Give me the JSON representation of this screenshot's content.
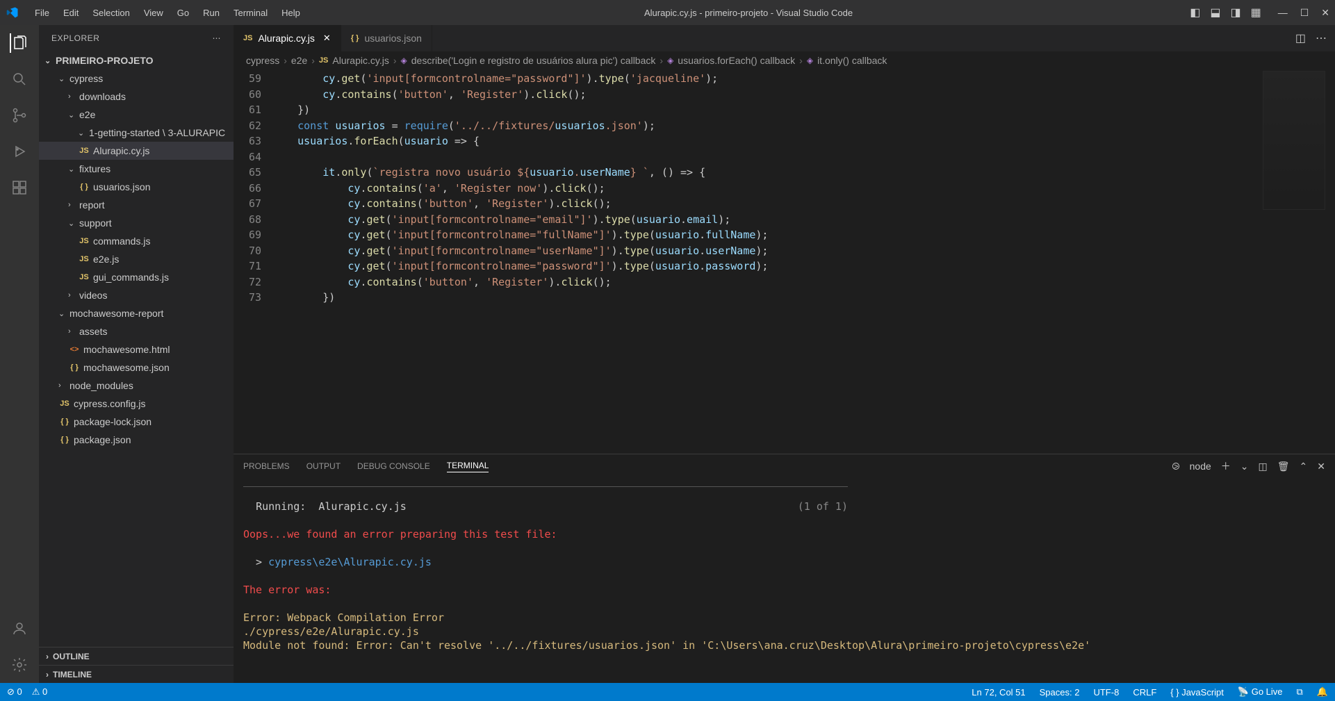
{
  "title": "Alurapic.cy.js - primeiro-projeto - Visual Studio Code",
  "menu": [
    "File",
    "Edit",
    "Selection",
    "View",
    "Go",
    "Run",
    "Terminal",
    "Help"
  ],
  "explorer": {
    "title": "EXPLORER",
    "root": "PRIMEIRO-PROJETO"
  },
  "tree": [
    {
      "label": "cypress",
      "type": "folder",
      "open": true,
      "indent": 1
    },
    {
      "label": "downloads",
      "type": "folder",
      "open": false,
      "indent": 2
    },
    {
      "label": "e2e",
      "type": "folder",
      "open": true,
      "indent": 2
    },
    {
      "label": "1-getting-started \\ 3-ALURAPIC",
      "type": "folder",
      "open": true,
      "indent": 3
    },
    {
      "label": "Alurapic.cy.js",
      "type": "js",
      "indent": 3,
      "selected": true
    },
    {
      "label": "fixtures",
      "type": "folder",
      "open": true,
      "indent": 2
    },
    {
      "label": "usuarios.json",
      "type": "json",
      "indent": 3
    },
    {
      "label": "report",
      "type": "folder",
      "open": false,
      "indent": 2
    },
    {
      "label": "support",
      "type": "folder",
      "open": true,
      "indent": 2
    },
    {
      "label": "commands.js",
      "type": "js",
      "indent": 3
    },
    {
      "label": "e2e.js",
      "type": "js",
      "indent": 3
    },
    {
      "label": "gui_commands.js",
      "type": "js",
      "indent": 3
    },
    {
      "label": "videos",
      "type": "folder",
      "open": false,
      "indent": 2
    },
    {
      "label": "mochawesome-report",
      "type": "folder",
      "open": true,
      "indent": 1
    },
    {
      "label": "assets",
      "type": "folder",
      "open": false,
      "indent": 2
    },
    {
      "label": "mochawesome.html",
      "type": "html",
      "indent": 2
    },
    {
      "label": "mochawesome.json",
      "type": "json",
      "indent": 2
    },
    {
      "label": "node_modules",
      "type": "folder",
      "open": false,
      "indent": 1
    },
    {
      "label": "cypress.config.js",
      "type": "js",
      "indent": 1
    },
    {
      "label": "package-lock.json",
      "type": "json",
      "indent": 1
    },
    {
      "label": "package.json",
      "type": "json",
      "indent": 1
    }
  ],
  "sections": {
    "outline": "OUTLINE",
    "timeline": "TIMELINE"
  },
  "tabs": [
    {
      "label": "Alurapic.cy.js",
      "icon": "js",
      "active": true
    },
    {
      "label": "usuarios.json",
      "icon": "json",
      "active": false
    }
  ],
  "breadcrumb": [
    "cypress",
    "e2e",
    "Alurapic.cy.js",
    "describe('Login e registro de usuários alura pic') callback",
    "usuarios.forEach() callback",
    "it.only() callback"
  ],
  "code": {
    "start": 59,
    "lines": [
      "        cy.get('input[formcontrolname=\"password\"]').type('jacqueline');",
      "        cy.contains('button', 'Register').click();",
      "    })",
      "    const usuarios = require('../../fixtures/usuarios.json');",
      "    usuarios.forEach(usuario => {",
      "",
      "        it.only(`registra novo usuário ${usuario.userName} `, () => {",
      "            cy.contains('a', 'Register now').click();",
      "            cy.contains('button', 'Register').click();",
      "            cy.get('input[formcontrolname=\"email\"]').type(usuario.email);",
      "            cy.get('input[formcontrolname=\"fullName\"]').type(usuario.fullName);",
      "            cy.get('input[formcontrolname=\"userName\"]').type(usuario.userName);",
      "            cy.get('input[formcontrolname=\"password\"]').type(usuario.password);",
      "            cy.contains('button', 'Register').click();",
      "        })"
    ]
  },
  "panel": {
    "tabs": [
      "PROBLEMS",
      "OUTPUT",
      "DEBUG CONSOLE",
      "TERMINAL"
    ],
    "active": 3,
    "shell": "node"
  },
  "terminal": {
    "running_label": "Running:",
    "running_file": "Alurapic.cy.js",
    "count": "(1 of 1)",
    "error1": "Oops...we found an error preparing this test file:",
    "path": "cypress\\e2e\\Alurapic.cy.js",
    "error_was": "The error was:",
    "err_head": "Error: Webpack Compilation Error",
    "err_file": "./cypress/e2e/Alurapic.cy.js",
    "err_mod": "Module not found: Error: Can't resolve '../../fixtures/usuarios.json' in 'C:\\Users\\ana.cruz\\Desktop\\Alura\\primeiro-projeto\\cypress\\e2e'"
  },
  "status": {
    "errors": "0",
    "warnings": "0",
    "ln_col": "Ln 72, Col 51",
    "spaces": "Spaces: 2",
    "encoding": "UTF-8",
    "eol": "CRLF",
    "lang": "JavaScript",
    "golive": "Go Live"
  }
}
